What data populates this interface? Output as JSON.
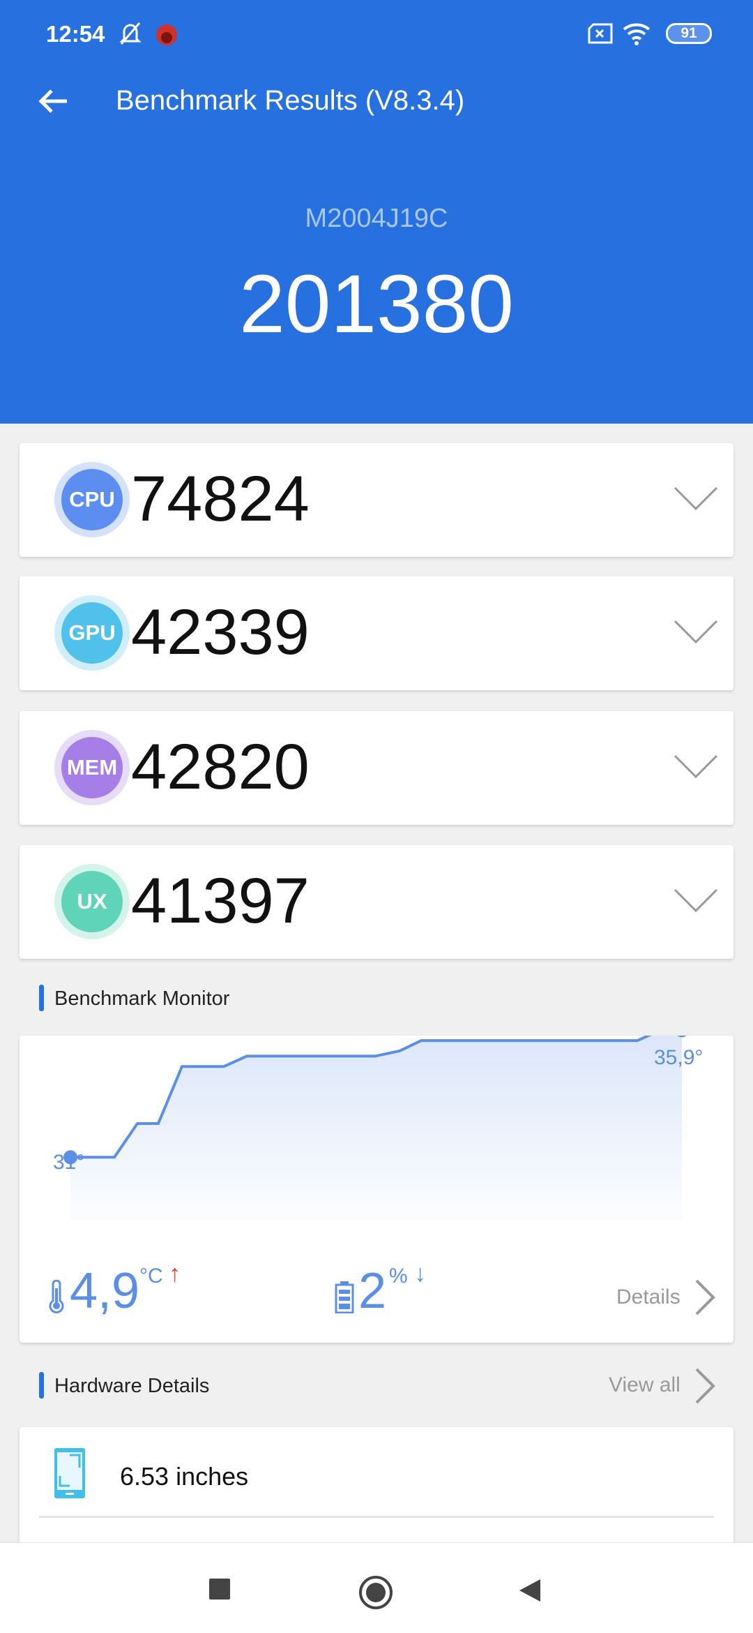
{
  "status": {
    "time": "12:54",
    "battery": "91"
  },
  "header": {
    "title": "Benchmark Results (V8.3.4)",
    "model": "M2004J19C",
    "total_score": "201380"
  },
  "scores": [
    {
      "label": "CPU",
      "value": "74824",
      "color": "#5b8ef0",
      "ring": "#d3e1fb"
    },
    {
      "label": "GPU",
      "value": "42339",
      "color": "#4fc1ea",
      "ring": "#d0eefa"
    },
    {
      "label": "MEM",
      "value": "42820",
      "color": "#a57ee8",
      "ring": "#e6dcf8"
    },
    {
      "label": "UX",
      "value": "41397",
      "color": "#5fd4b8",
      "ring": "#d3f3eb"
    }
  ],
  "monitor": {
    "section_title": "Benchmark Monitor",
    "start_label": "31°",
    "end_label": "35,9°",
    "temp_rise": "4,9",
    "temp_unit": "°C",
    "battery_drop": "2",
    "battery_unit": "%",
    "details_label": "Details"
  },
  "chart_data": {
    "type": "line",
    "series": [
      {
        "values": [
          31,
          31,
          32.3,
          32.3,
          34.5,
          34.5,
          34.9,
          34.9,
          35.1,
          35.5,
          35.5,
          35.9,
          35.9
        ]
      }
    ],
    "ylim": [
      29.5,
      36.5
    ],
    "grid": false,
    "color": "#5b8ee6"
  },
  "hardware": {
    "section_title": "Hardware Details",
    "view_all": "View all",
    "items": [
      {
        "icon": "phone-screen-icon",
        "text": "6.53 inches"
      }
    ]
  }
}
